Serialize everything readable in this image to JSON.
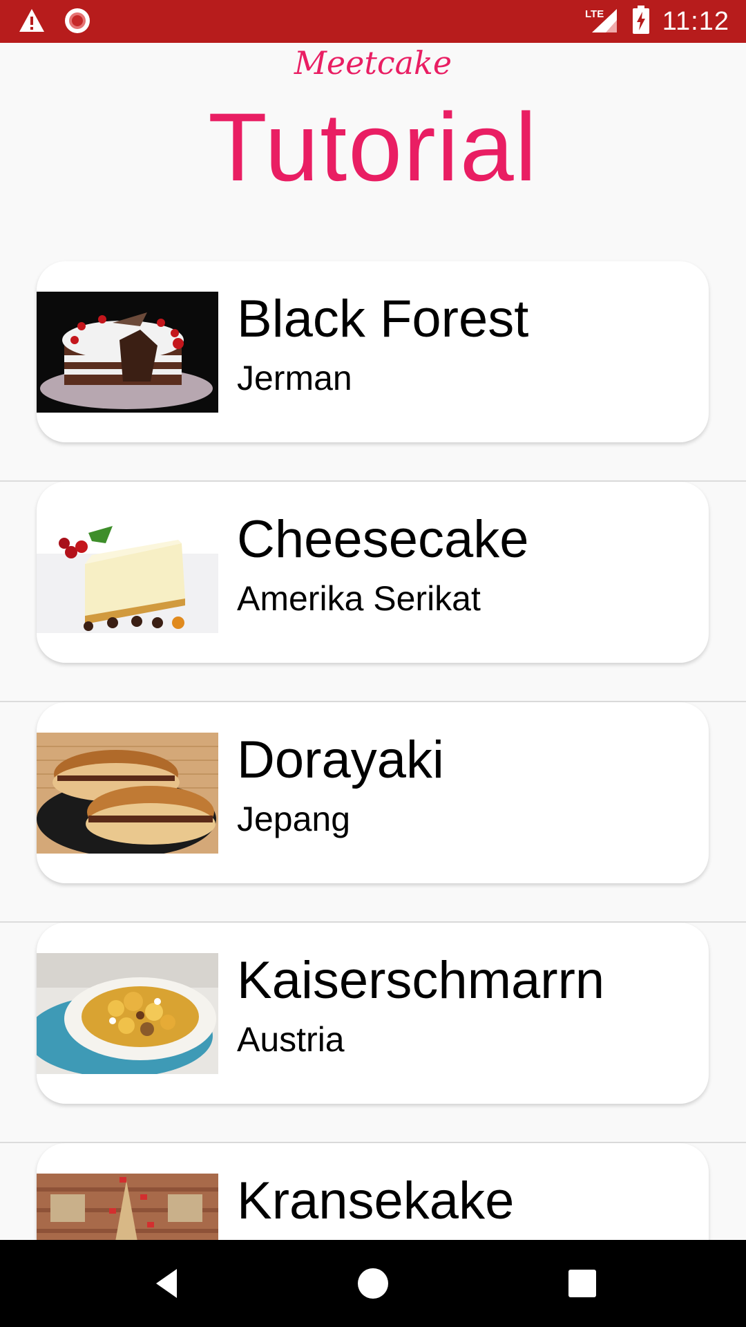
{
  "status_bar": {
    "time": "11:12",
    "network": "LTE",
    "background_color": "#b71c1c",
    "icons": [
      "warning-icon",
      "record-icon",
      "signal-icon",
      "battery-charging-icon"
    ]
  },
  "header": {
    "app_name": "Meetcake",
    "title": "Tutorial",
    "accent_color": "#e91e63"
  },
  "cakes": [
    {
      "name": "Black Forest",
      "origin": "Jerman"
    },
    {
      "name": "Cheesecake",
      "origin": "Amerika Serikat"
    },
    {
      "name": "Dorayaki",
      "origin": "Jepang"
    },
    {
      "name": "Kaiserschmarrn",
      "origin": "Austria"
    },
    {
      "name": "Kransekake",
      "origin": ""
    }
  ],
  "nav_bar": {
    "icons": [
      "back-icon",
      "home-icon",
      "recents-icon"
    ]
  }
}
